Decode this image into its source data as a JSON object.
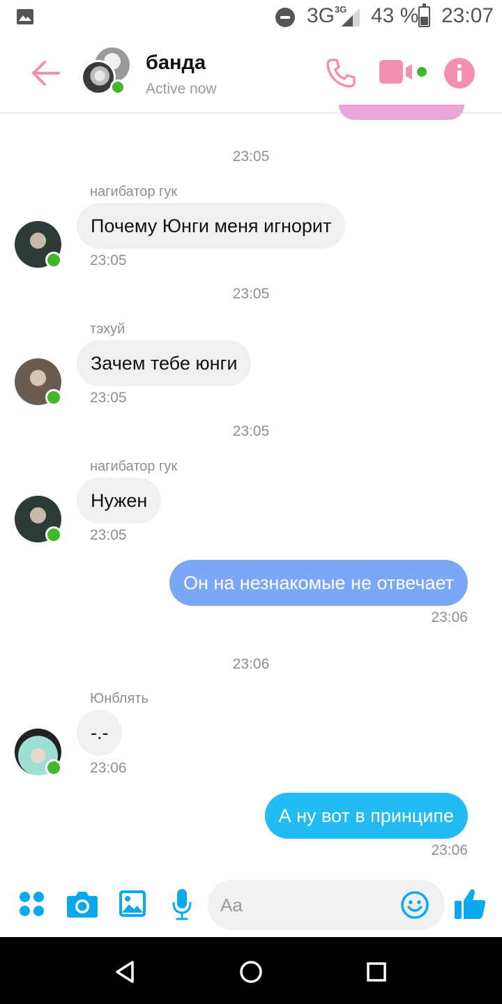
{
  "status_bar": {
    "network": "3G",
    "network_sup": "3G",
    "battery_pct": "43 %",
    "battery_level": 0.43,
    "time": "23:07"
  },
  "header": {
    "title": "банда",
    "subtitle": "Active now"
  },
  "messages": [
    {
      "type": "timestamp",
      "text": "23:05"
    },
    {
      "type": "incoming",
      "sender": "нагибатор гук",
      "text": "Почему Юнги меня игнорит",
      "time": "23:05",
      "avatar_icon": "avatar-icon"
    },
    {
      "type": "timestamp",
      "text": "23:05"
    },
    {
      "type": "incoming",
      "sender": "тэхуй",
      "text": "Зачем тебе юнги",
      "time": "23:05",
      "avatar_icon": "avatar-icon"
    },
    {
      "type": "timestamp",
      "text": "23:05"
    },
    {
      "type": "incoming",
      "sender": "нагибатор гук",
      "text": "Нужен",
      "time": "23:05",
      "avatar_icon": "avatar-icon"
    },
    {
      "type": "outgoing",
      "text": "Он на незнакомые не отвечает",
      "time": "23:06"
    },
    {
      "type": "timestamp",
      "text": "23:06"
    },
    {
      "type": "incoming",
      "sender": "Юнблять",
      "text": "-.-",
      "time": "23:06",
      "avatar_icon": "avatar-icon"
    },
    {
      "type": "outgoing",
      "text": "А ну вот в принципе",
      "time": "23:06"
    }
  ],
  "composer": {
    "placeholder": "Aa"
  },
  "colors": {
    "accent_pink": "#f48fb1",
    "outgoing_bubble_1": "#7aa7f8",
    "outgoing_bubble_2": "#22bcf3",
    "incoming_bubble": "#f1f0f0",
    "online": "#42b72a",
    "composer_icons": "#0aa8f0"
  }
}
